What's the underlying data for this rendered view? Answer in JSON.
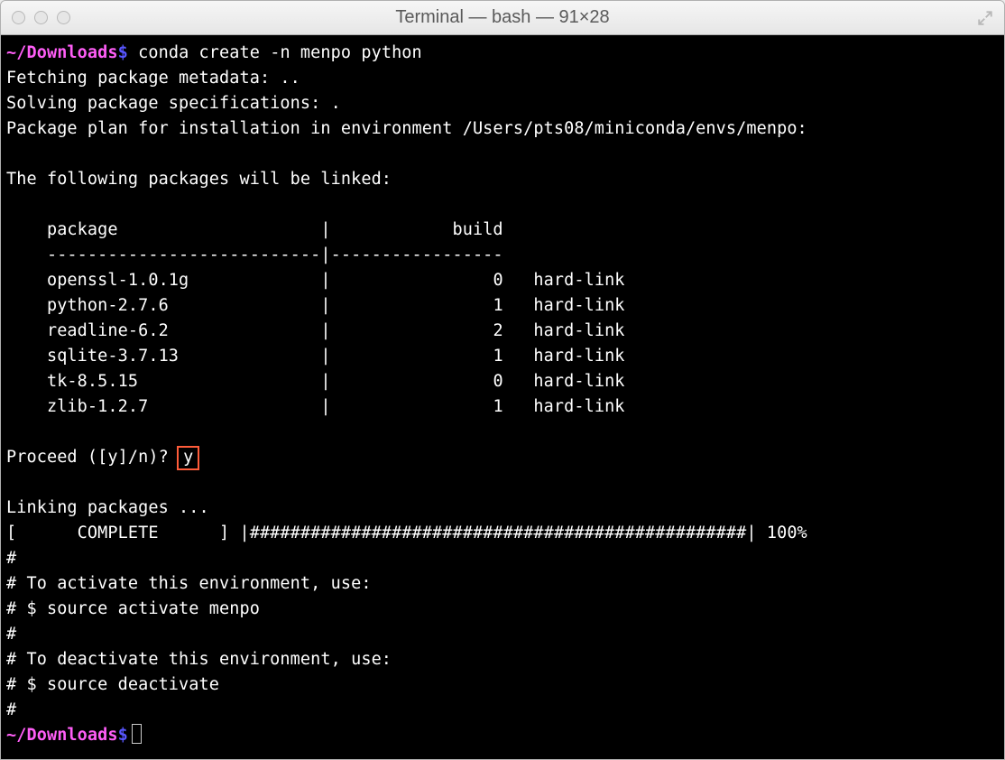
{
  "titlebar": {
    "title": "Terminal — bash — 91×28"
  },
  "prompt": {
    "path": "~/Downloads",
    "dollar": "$"
  },
  "session": {
    "command": "conda create -n menpo python",
    "fetch": "Fetching package metadata: ..",
    "solve": "Solving package specifications: .",
    "plan": "Package plan for installation in environment /Users/pts08/miniconda/envs/menpo:",
    "linked_header": "The following packages will be linked:",
    "table_header_package": "package",
    "table_header_build": "build",
    "table_divider": "---------------------------|-----------------",
    "packages": [
      {
        "name": "openssl-1.0.1g",
        "build": "0",
        "link": "hard-link"
      },
      {
        "name": "python-2.7.6",
        "build": "1",
        "link": "hard-link"
      },
      {
        "name": "readline-6.2",
        "build": "2",
        "link": "hard-link"
      },
      {
        "name": "sqlite-3.7.13",
        "build": "1",
        "link": "hard-link"
      },
      {
        "name": "tk-8.5.15",
        "build": "0",
        "link": "hard-link"
      },
      {
        "name": "zlib-1.2.7",
        "build": "1",
        "link": "hard-link"
      }
    ],
    "proceed_prompt": "Proceed ([y]/n)?",
    "proceed_answer": "y",
    "linking": "Linking packages ...",
    "progress": "[      COMPLETE      ] |#################################################| 100%",
    "notes": [
      "#",
      "# To activate this environment, use:",
      "# $ source activate menpo",
      "#",
      "# To deactivate this environment, use:",
      "# $ source deactivate",
      "#"
    ]
  }
}
